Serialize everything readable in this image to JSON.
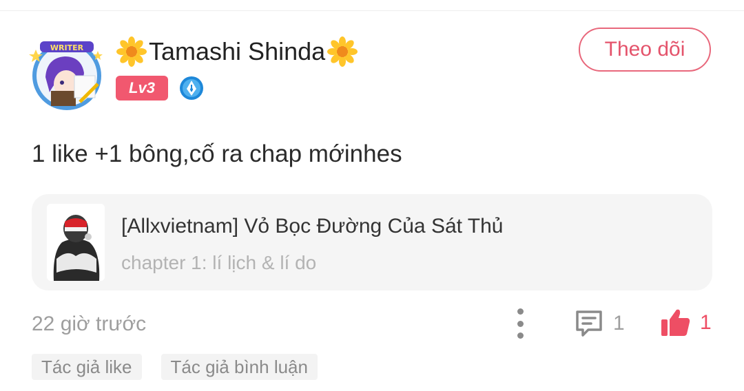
{
  "user": {
    "name": "Tamashi Shinda",
    "level": "Lv3",
    "avatar_label": "WRITER",
    "flower_icon": "sunflower-icon",
    "writer_icon": "pen-nib-icon"
  },
  "follow_label": "Theo dõi",
  "comment": {
    "text": "1 like +1 bông,cố ra chap mớinhes"
  },
  "story": {
    "title": "[Allxvietnam] Vỏ Bọc Đường Của Sát Thủ",
    "chapter": "chapter 1: lí lịch & lí do"
  },
  "meta": {
    "timestamp": "22 giờ trước",
    "comments_count": "1",
    "likes_count": "1"
  },
  "tags": [
    "Tác giả like",
    "Tác giả bình luận"
  ],
  "colors": {
    "accent": "#f1586f",
    "follow_border": "#e8677b",
    "writer_badge": "#1e88d9",
    "muted_text": "#9e9e9e"
  }
}
